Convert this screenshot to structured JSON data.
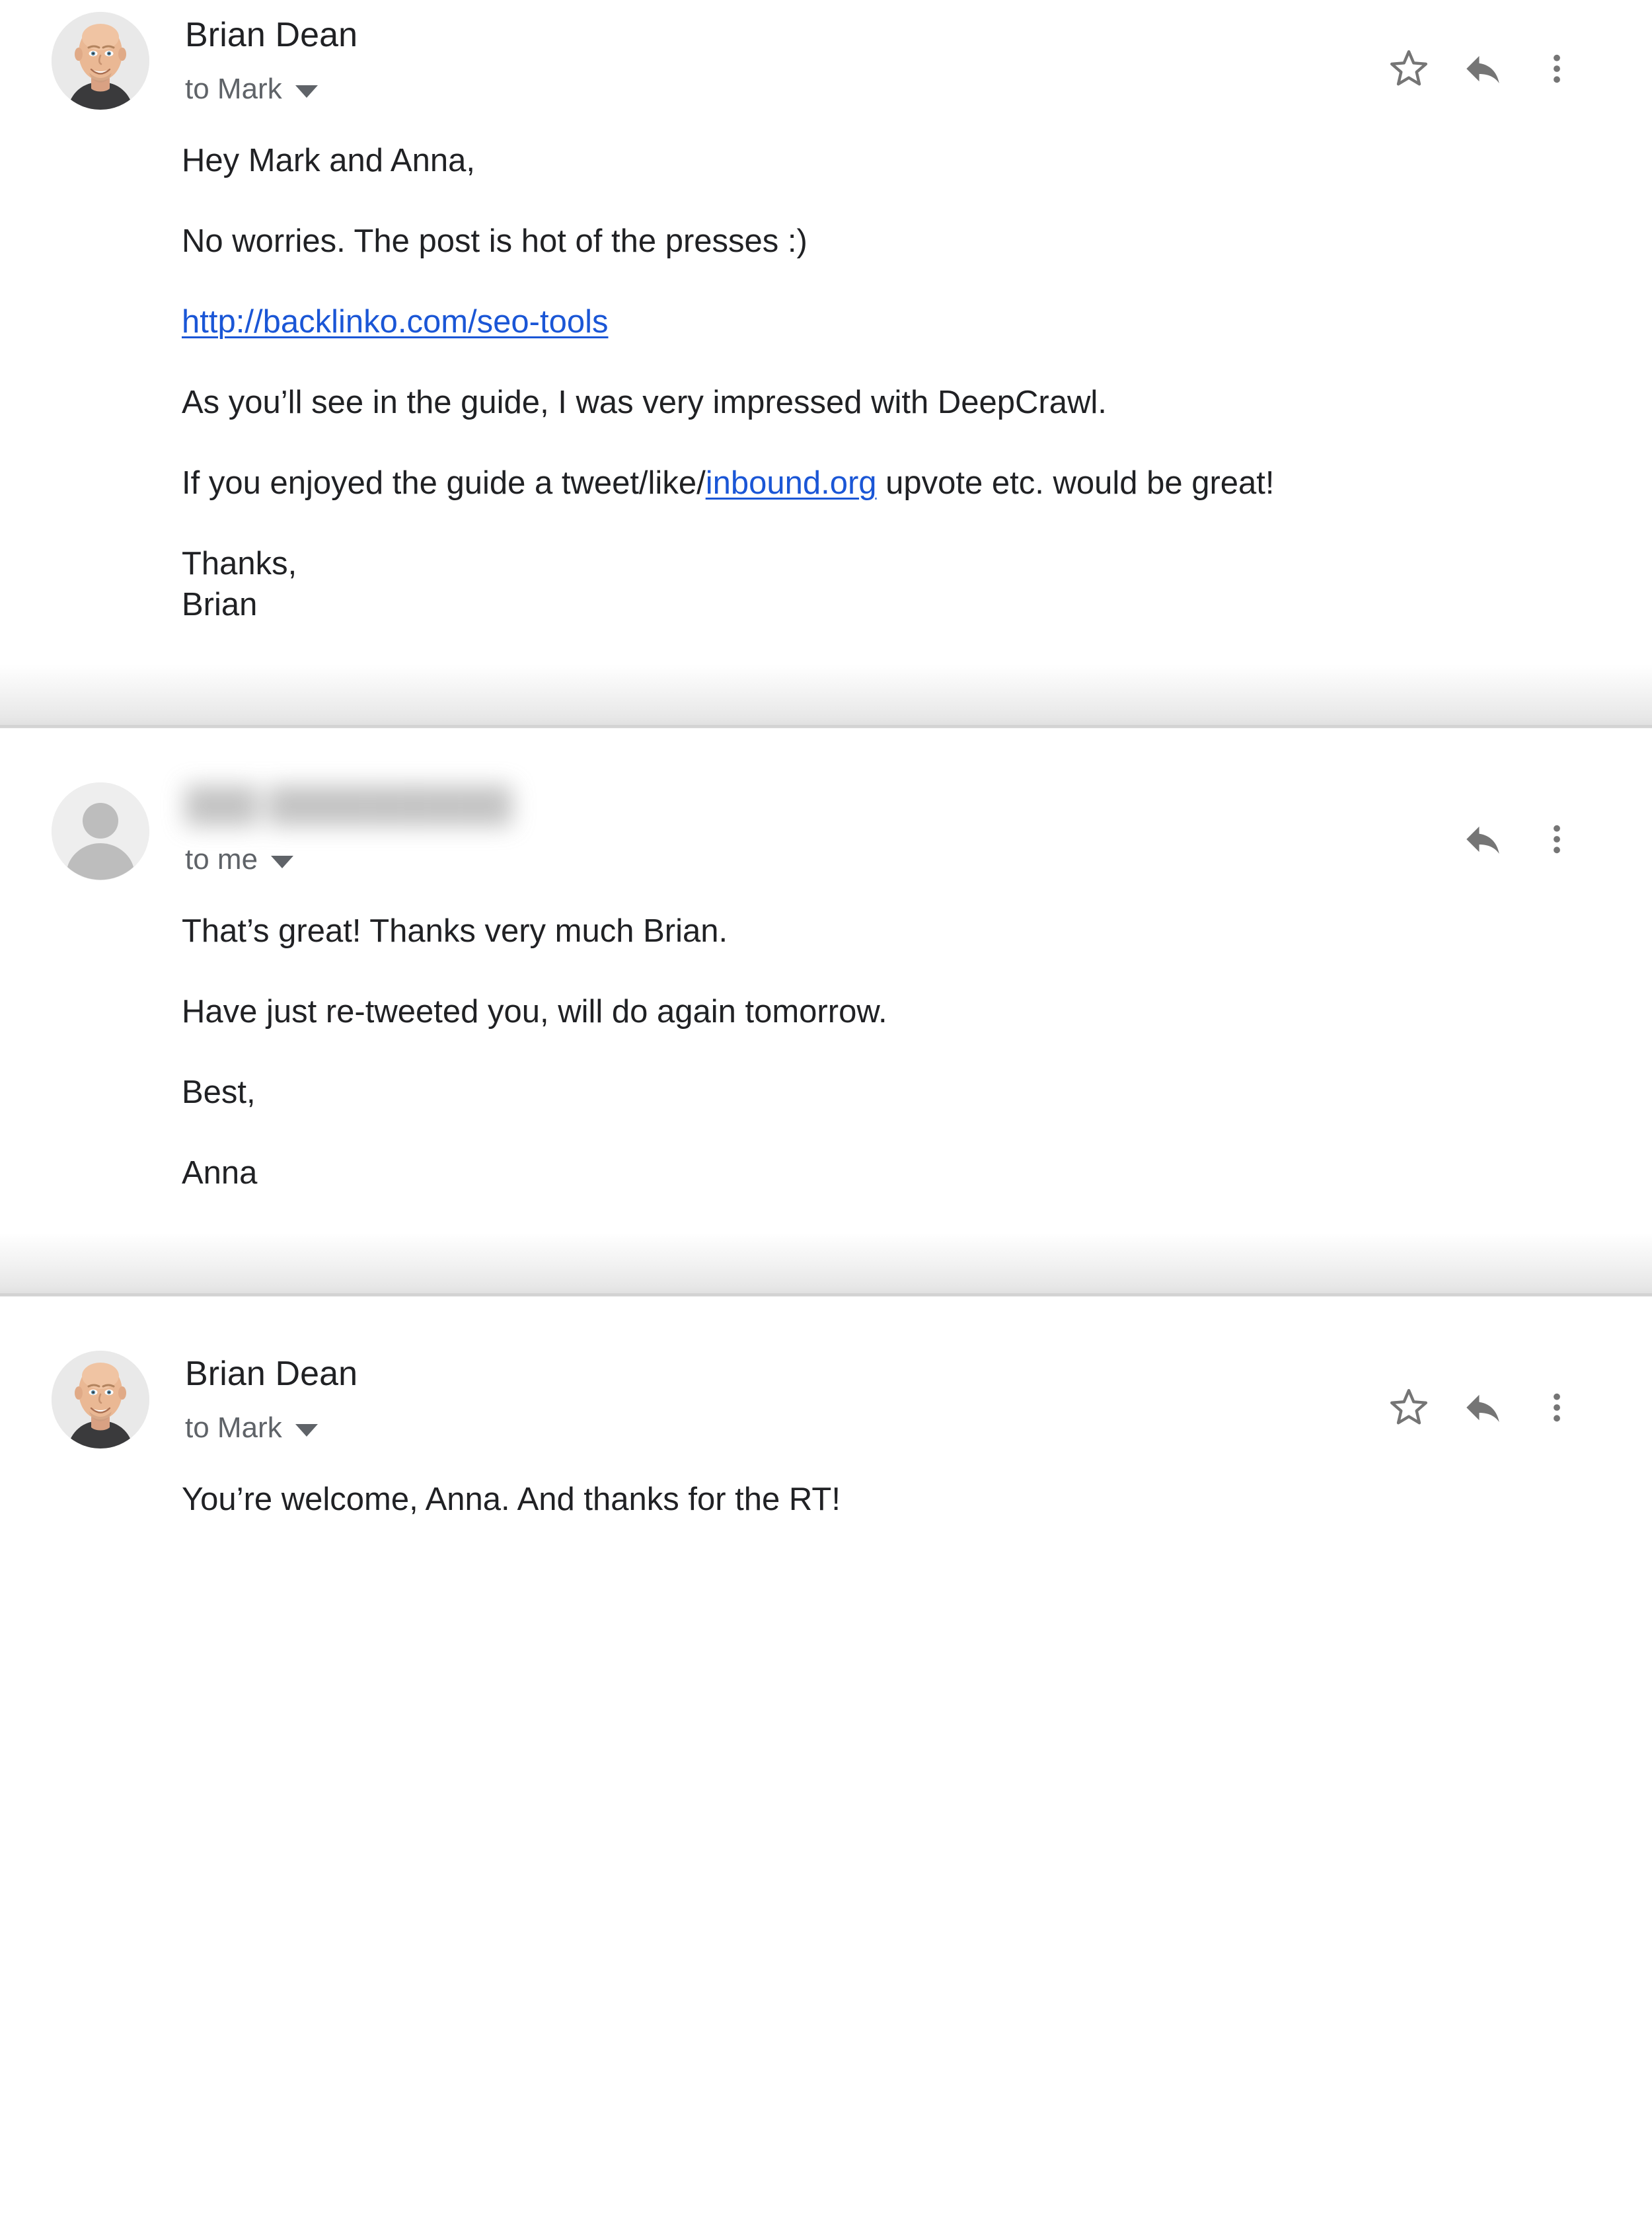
{
  "thread": {
    "messages": [
      {
        "id": "msg-1",
        "sender": "Brian Dean",
        "sender_redacted": false,
        "avatar_type": "photo",
        "recipient": "to Mark",
        "actions": [
          "star-icon",
          "reply-icon",
          "more-options-icon"
        ],
        "paragraphs": [
          {
            "type": "text",
            "text": "Hey Mark and Anna,"
          },
          {
            "type": "text",
            "text": "No worries. The post is hot of the presses :)"
          },
          {
            "type": "link",
            "text": "http://backlinko.com/seo-tools",
            "href": "http://backlinko.com/seo-tools"
          },
          {
            "type": "text",
            "text": "As you’ll see in the guide, I was very impressed with DeepCrawl."
          },
          {
            "type": "rich",
            "before": "If you enjoyed the guide a tweet/like/",
            "link": "inbound.org",
            "after": " upvote etc. would be great!"
          },
          {
            "type": "text",
            "text": "Thanks,"
          },
          {
            "type": "text",
            "text": "Brian"
          }
        ]
      },
      {
        "id": "msg-2",
        "sender": "███ ██████████",
        "sender_redacted": true,
        "avatar_type": "default",
        "recipient": "to me",
        "actions": [
          "reply-icon",
          "more-options-icon"
        ],
        "paragraphs": [
          {
            "type": "text",
            "text": "That’s great! Thanks very much Brian."
          },
          {
            "type": "text",
            "text": "Have just re-tweeted you, will do again tomorrow."
          },
          {
            "type": "text",
            "text": "Best,"
          },
          {
            "type": "text",
            "text": "Anna"
          }
        ]
      },
      {
        "id": "msg-3",
        "sender": "Brian Dean",
        "sender_redacted": false,
        "avatar_type": "photo",
        "recipient": "to Mark",
        "actions": [
          "star-icon",
          "reply-icon",
          "more-options-icon"
        ],
        "paragraphs": [
          {
            "type": "text",
            "text": "You’re welcome, Anna. And thanks for the RT!"
          }
        ]
      }
    ]
  },
  "colors": {
    "link": "#1a56d6",
    "body_text": "#202124",
    "secondary_text": "#5f6368",
    "icon": "#757575",
    "avatar_bg": "#e8e8e8",
    "avatar_silhouette": "#bdbdbd",
    "page_bg": "#ffffff"
  },
  "icons": {
    "star": "star-icon",
    "reply": "reply-icon",
    "more": "more-options-icon",
    "caret": "chevron-down-icon"
  }
}
